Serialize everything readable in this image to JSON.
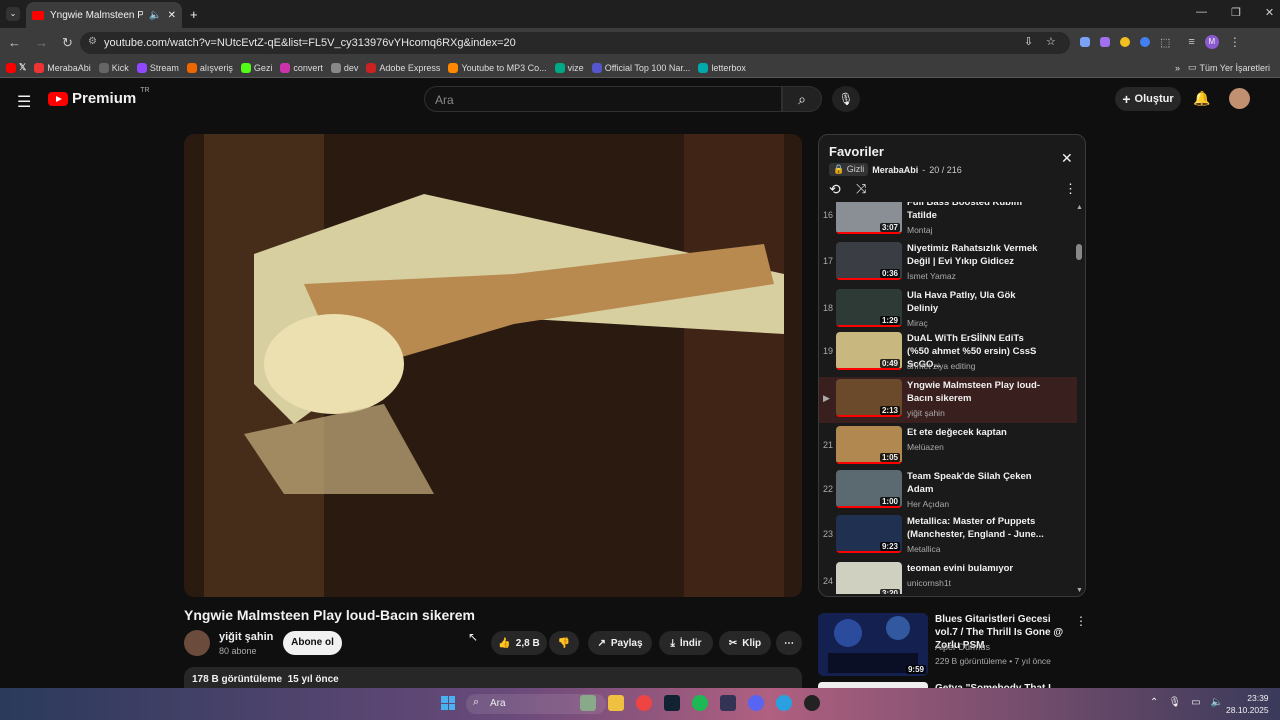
{
  "browser": {
    "tab_title": "Yngwie Malmsteen Play lou",
    "url": "youtube.com/watch?v=NUtcEvtZ-qE&list=FL5V_cy313976vYHcomq6RXg&index=20",
    "bookmarks": [
      "MerabaAbi",
      "Kick",
      "Stream",
      "alışveriş",
      "Gezi",
      "convert",
      "dev",
      "Adobe Express",
      "Youtube to MP3 Co...",
      "vize",
      "Official Top 100 Nar...",
      "letterbox"
    ],
    "bookmarks_all": "Tüm Yer İşaretleri",
    "colors": {
      "accent": "#ff0000"
    }
  },
  "masthead": {
    "logo": "Premium",
    "region": "TR",
    "search_placeholder": "Ara",
    "create_label": "Oluştur"
  },
  "video": {
    "title": "Yngwie Malmsteen Play loud-Bacın sikerem",
    "channel": "yiğit şahin",
    "subscribers": "80 abone",
    "subscribe_label": "Abone ol",
    "likes": "2,8 B",
    "share_label": "Paylaş",
    "download_label": "İndir",
    "clip_label": "Klip",
    "views": "178 B görüntüleme",
    "age": "15 yıl önce"
  },
  "playlist": {
    "title": "Favoriler",
    "privacy": "Gizli",
    "owner": "MerabaAbi",
    "position": "20 / 216",
    "items": [
      {
        "index": "16",
        "title": "Full Bass Boosted Kubim Tatilde",
        "author": "Montaj",
        "duration": "3:07",
        "thumb": "#8a8f96"
      },
      {
        "index": "17",
        "title": "Niyetimiz Rahatsızlık Vermek Değil | Evi Yıkıp Gidicez",
        "author": "İsmet Yamaz",
        "duration": "0:36",
        "thumb": "#3a3e44"
      },
      {
        "index": "18",
        "title": "Ula Hava Patlıy, Ula Gök Deliniy",
        "author": "Miraç",
        "duration": "1:29",
        "thumb": "#2e3a36"
      },
      {
        "index": "19",
        "title": "DuAL WiTh ErSİİNN EdiTs (%50 ahmet %50 ersin) CssS ScGO...",
        "author": "ahmet ziya editing",
        "duration": "0:49",
        "thumb": "#c8b880"
      },
      {
        "index": "▶",
        "title": "Yngwie Malmsteen Play loud-Bacın sikerem",
        "author": "yiğit şahin",
        "duration": "2:13",
        "thumb": "#6a4a2a"
      },
      {
        "index": "21",
        "title": "Et ete değecek kaptan",
        "author": "Melüazen",
        "duration": "1:05",
        "thumb": "#b08850"
      },
      {
        "index": "22",
        "title": "Team Speak'de Silah Çeken Adam",
        "author": "Her Açıdan",
        "duration": "1:00",
        "thumb": "#5a6a70"
      },
      {
        "index": "23",
        "title": "Metallica: Master of Puppets (Manchester, England - June...",
        "author": "Metallica",
        "duration": "9:23",
        "thumb": "#203050"
      },
      {
        "index": "24",
        "title": "teoman evini bulamıyor",
        "author": "unicornsh1t",
        "duration": "3:20",
        "thumb": "#d0d0c0"
      }
    ]
  },
  "recommended": [
    {
      "title": "Blues Gitaristleri Gecesi vol.7 / The Thrill Is Gone @ Zorlu PSM",
      "channel": "Alper Durmus",
      "meta": "229 B görüntüleme • 7 yıl önce",
      "duration": "9:59"
    },
    {
      "title": "Getva \"Somebody That I Used"
    }
  ],
  "taskbar": {
    "search": "Ara",
    "time": "23:39",
    "date": "28.10.2025"
  }
}
